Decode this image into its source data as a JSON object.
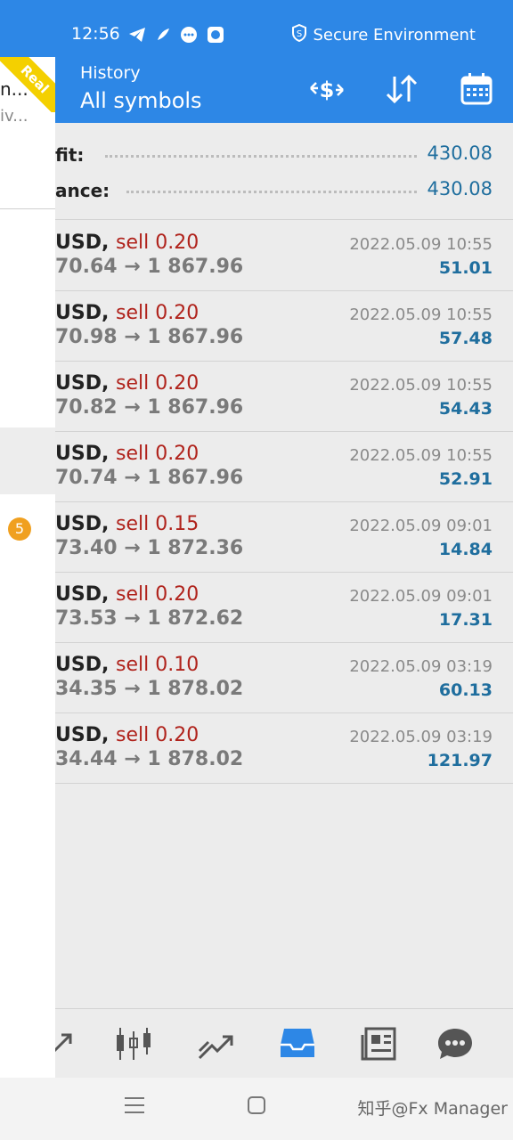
{
  "status_bar": {
    "time": "12:56",
    "secure_text": "Secure Environment"
  },
  "header": {
    "subtitle": "History",
    "title": "All symbols"
  },
  "summary": {
    "profit_label": "fit:",
    "profit_value": "430.08",
    "balance_label": "ance:",
    "balance_value": "430.08"
  },
  "deals": [
    {
      "symbol": "USD,",
      "side": "sell 0.20",
      "prices": "70.64 → 1 867.96",
      "date": "2022.05.09 10:55",
      "profit": "51.01"
    },
    {
      "symbol": "USD,",
      "side": "sell 0.20",
      "prices": "70.98 → 1 867.96",
      "date": "2022.05.09 10:55",
      "profit": "57.48"
    },
    {
      "symbol": "USD,",
      "side": "sell 0.20",
      "prices": "70.82 → 1 867.96",
      "date": "2022.05.09 10:55",
      "profit": "54.43"
    },
    {
      "symbol": "USD,",
      "side": "sell 0.20",
      "prices": "70.74 → 1 867.96",
      "date": "2022.05.09 10:55",
      "profit": "52.91"
    },
    {
      "symbol": "USD,",
      "side": "sell 0.15",
      "prices": "73.40 → 1 872.36",
      "date": "2022.05.09 09:01",
      "profit": "14.84"
    },
    {
      "symbol": "USD,",
      "side": "sell 0.20",
      "prices": "73.53 → 1 872.62",
      "date": "2022.05.09 09:01",
      "profit": "17.31"
    },
    {
      "symbol": "USD,",
      "side": "sell 0.10",
      "prices": "34.35 → 1 878.02",
      "date": "2022.05.09 03:19",
      "profit": "60.13"
    },
    {
      "symbol": "USD,",
      "side": "sell 0.20",
      "prices": "34.44 → 1 878.02",
      "date": "2022.05.09 03:19",
      "profit": "121.97"
    }
  ],
  "drawer": {
    "account_line1": "n...",
    "account_line2": "iv...",
    "badge_count": "5",
    "ribbon_text": "Real"
  },
  "watermark": "知乎@Fx Manager",
  "colors": {
    "accent": "#2d87e6",
    "sell": "#b0231c",
    "profit": "#1f6e9e",
    "badge": "#f0a020",
    "ribbon": "#f4d000"
  },
  "icons": {
    "header": [
      "currency-exchange-icon",
      "sort-icon",
      "calendar-icon"
    ],
    "bottom_nav": [
      "chart-icon",
      "candlesticks-icon",
      "trade-icon",
      "history-inbox-icon",
      "news-icon",
      "chat-icon"
    ],
    "system_nav": [
      "menu-icon",
      "home-icon"
    ]
  }
}
